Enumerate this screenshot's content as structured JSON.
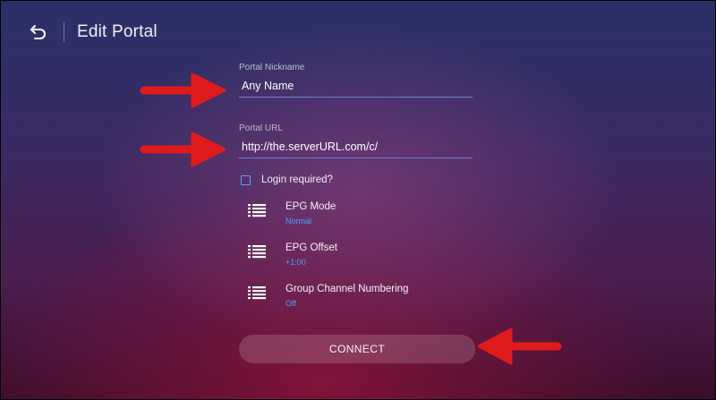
{
  "header": {
    "title": "Edit Portal",
    "back_icon": "back-arrow-icon"
  },
  "form": {
    "nickname": {
      "label": "Portal Nickname",
      "value": "Any Name"
    },
    "url": {
      "label": "Portal URL",
      "value": "http://the.serverURL.com/c/"
    },
    "login_required": {
      "label": "Login required?",
      "checked": false
    }
  },
  "settings": [
    {
      "title": "EPG Mode",
      "value": "Normal",
      "icon": "list-icon"
    },
    {
      "title": "EPG Offset",
      "value": "+1:00",
      "icon": "list-icon"
    },
    {
      "title": "Group Channel Numbering",
      "value": "Off",
      "icon": "list-icon"
    }
  ],
  "connect_label": "CONNECT",
  "colors": {
    "accent": "#4f9dff",
    "annotation_arrow": "#e01b1b",
    "underline": "#6f7fd0"
  }
}
